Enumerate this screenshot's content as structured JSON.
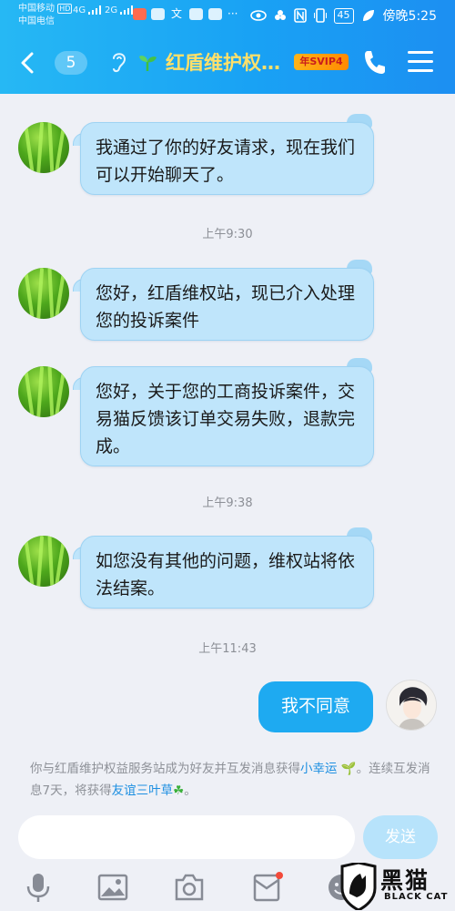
{
  "status_bar": {
    "carrier_1": "中国移动",
    "carrier_1_badge": "HD",
    "carrier_2": "中国电信",
    "network_1": "4G",
    "network_2": "2G",
    "battery": "45",
    "time": "傍晚5:25"
  },
  "header": {
    "unread_count": "5",
    "title": "红盾维护权…",
    "vip_badge": "年SVIP4",
    "accent_color": "#ffe06a",
    "icons": [
      "back-chevron-icon",
      "ear-icon",
      "sprout-icon",
      "phone-icon",
      "menu-icon"
    ]
  },
  "messages": [
    {
      "from": "other",
      "text": "我通过了你的好友请求，现在我们可以开始聊天了。"
    },
    {
      "type": "time",
      "text": "上午9:30"
    },
    {
      "from": "other",
      "text": "您好，红盾维权站，现已介入处理您的投诉案件"
    },
    {
      "from": "other",
      "text": "您好，关于您的工商投诉案件，交易猫反馈该订单交易失败，退款完成。"
    },
    {
      "type": "time",
      "text": "上午9:38"
    },
    {
      "from": "other",
      "text": "如您没有其他的问题，维权站将依法结案。"
    },
    {
      "type": "time",
      "text": "上午11:43"
    },
    {
      "from": "me",
      "text": "我不同意"
    }
  ],
  "notice": {
    "part1": "你与红盾维护权益服务站成为好友并互发消息获得",
    "link1": "小幸运",
    "part2": "。连续互发消息7天，将获得",
    "link2": "友谊三叶草",
    "part3": "。"
  },
  "composer": {
    "input_value": "",
    "send_label": "发送",
    "tools": [
      "microphone-icon",
      "image-icon",
      "camera-icon",
      "red-packet-icon",
      "emoji-icon"
    ]
  },
  "watermark": {
    "text": "黑猫",
    "subtext": "BLACK CAT"
  },
  "colors": {
    "header_gradient_start": "#26b8f4",
    "header_gradient_end": "#1c8ff2",
    "other_bubble": "#bfe5fb",
    "my_bubble": "#1eaaf1",
    "background": "#eef0f6"
  }
}
